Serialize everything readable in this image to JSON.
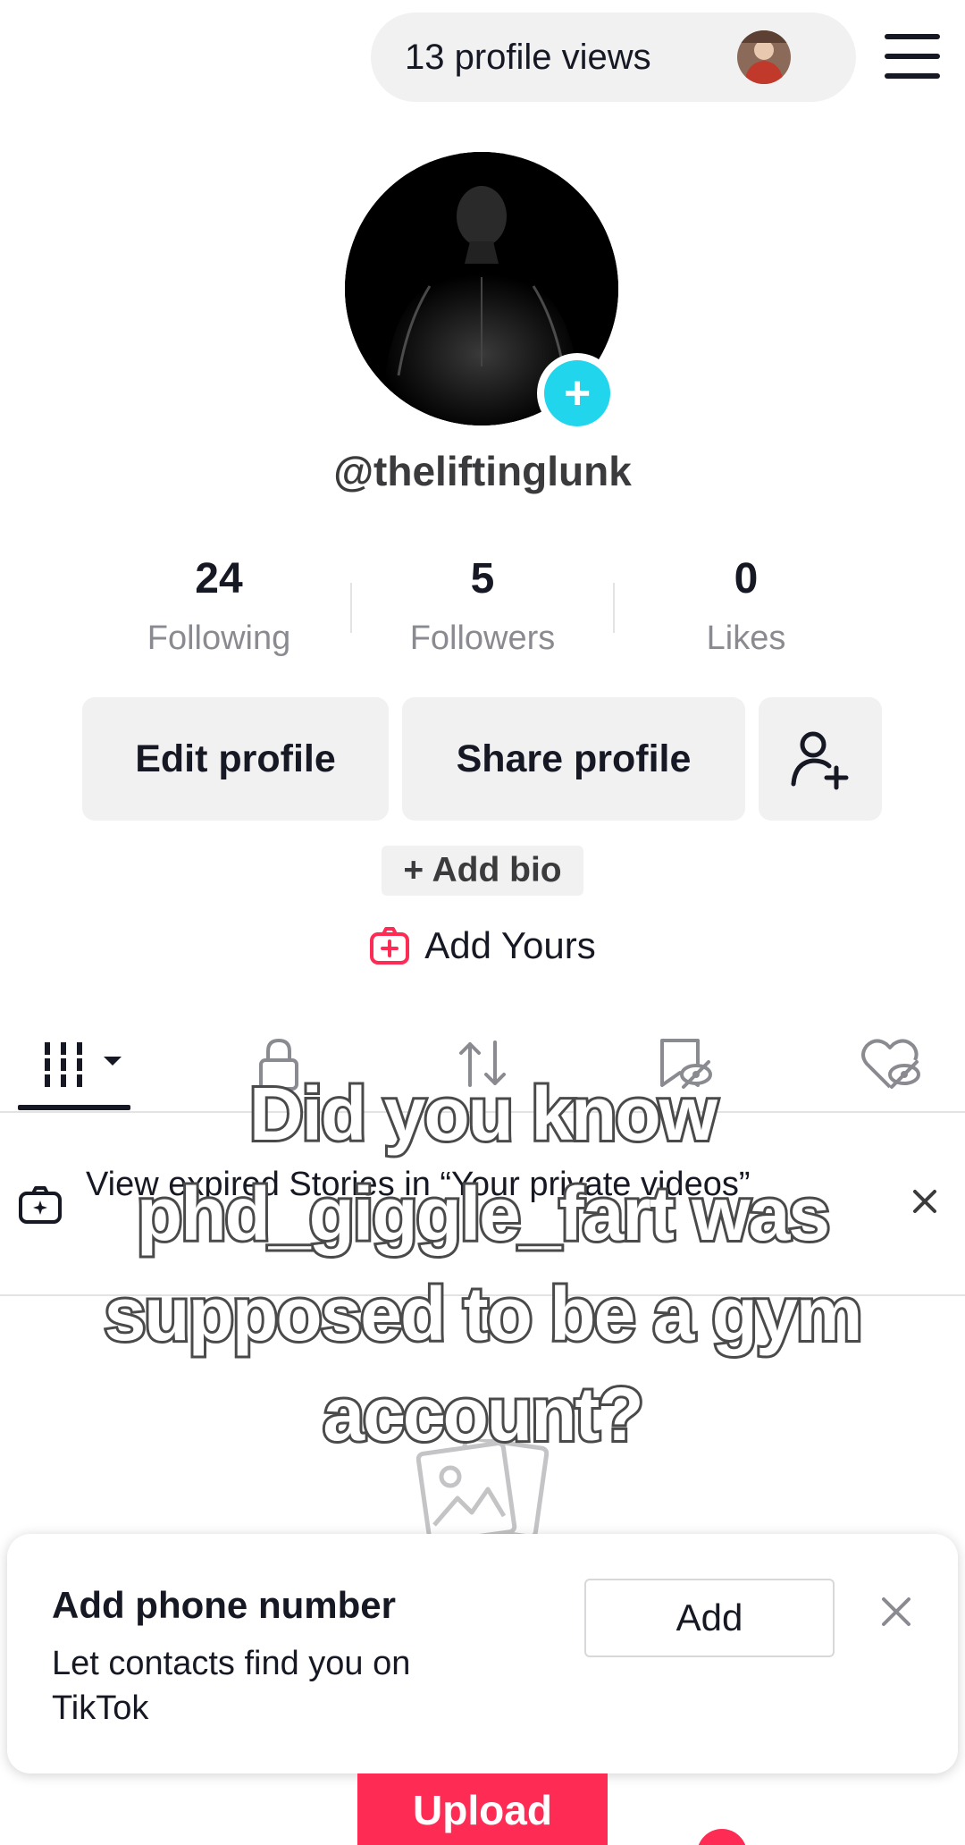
{
  "header": {
    "profile_views": "13 profile views",
    "menu_icon": "hamburger-menu-icon"
  },
  "profile": {
    "username": "@theliftinglunk",
    "avatar_add_symbol": "+"
  },
  "stats": [
    {
      "value": "24",
      "label": "Following"
    },
    {
      "value": "5",
      "label": "Followers"
    },
    {
      "value": "0",
      "label": "Likes"
    }
  ],
  "actions": {
    "edit_profile": "Edit profile",
    "share_profile": "Share profile",
    "add_friend_icon": "add-friend-icon"
  },
  "add_bio": "+ Add bio",
  "add_yours": "Add Yours",
  "tabs": [
    {
      "icon": "videos-grid-icon",
      "selected": true
    },
    {
      "icon": "lock-icon",
      "selected": false
    },
    {
      "icon": "repost-icon",
      "selected": false
    },
    {
      "icon": "hidden-favorites-icon",
      "selected": false
    },
    {
      "icon": "hidden-likes-icon",
      "selected": false
    }
  ],
  "stories_banner": {
    "text": "View expired Stories in “Your private videos”"
  },
  "phone_prompt": {
    "title": "Add phone number",
    "subtitle": "Let contacts find you on TikTok",
    "add_label": "Add"
  },
  "upload_label": "Upload",
  "overlay_caption": {
    "lines": [
      "Did you know",
      "phd_giggle_fart was",
      "supposed to be a gym",
      "account?"
    ]
  },
  "colors": {
    "accent_red": "#fe2c55",
    "accent_cyan": "#20d5ec",
    "text_primary": "#161823",
    "text_secondary": "#8a8b91",
    "button_bg": "#f1f1f2"
  }
}
